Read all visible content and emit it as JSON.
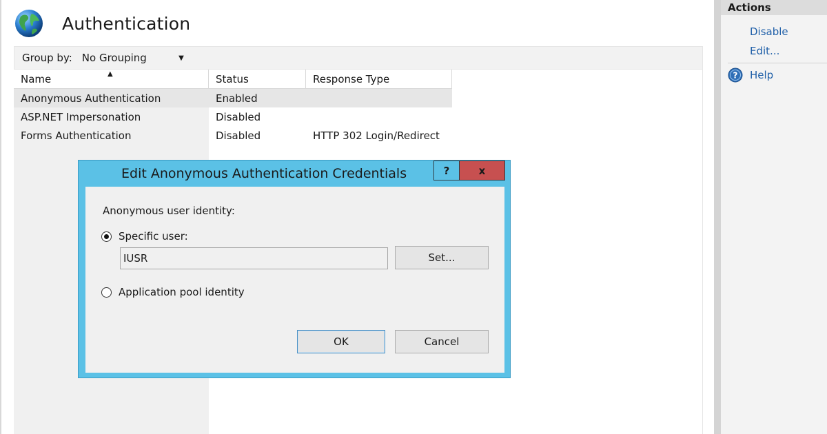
{
  "header": {
    "title": "Authentication"
  },
  "groupbar": {
    "label": "Group by:",
    "selected": "No Grouping"
  },
  "table": {
    "columns": [
      "Name",
      "Status",
      "Response Type"
    ],
    "rows": [
      {
        "name": "Anonymous Authentication",
        "status": "Enabled",
        "response_type": "",
        "selected": true
      },
      {
        "name": "ASP.NET Impersonation",
        "status": "Disabled",
        "response_type": ""
      },
      {
        "name": "Forms Authentication",
        "status": "Disabled",
        "response_type": "HTTP 302 Login/Redirect"
      }
    ]
  },
  "actions": {
    "title": "Actions",
    "disable_label": "Disable",
    "edit_label": "Edit...",
    "help_label": "Help"
  },
  "dialog": {
    "title": "Edit Anonymous Authentication Credentials",
    "help_button": "?",
    "close_button": "x",
    "identity_label": "Anonymous user identity:",
    "specific_user_label": "Specific user:",
    "specific_user_value": "IUSR",
    "set_button": "Set...",
    "pool_identity_label": "Application pool identity",
    "ok_button": "OK",
    "cancel_button": "Cancel",
    "selected_option": "specific_user"
  },
  "colors": {
    "dialog_frame": "#5bc1e6",
    "close_button": "#c75050",
    "link": "#1f5fa8"
  },
  "icons": {
    "header": "globe-icon",
    "help": "help-icon"
  }
}
